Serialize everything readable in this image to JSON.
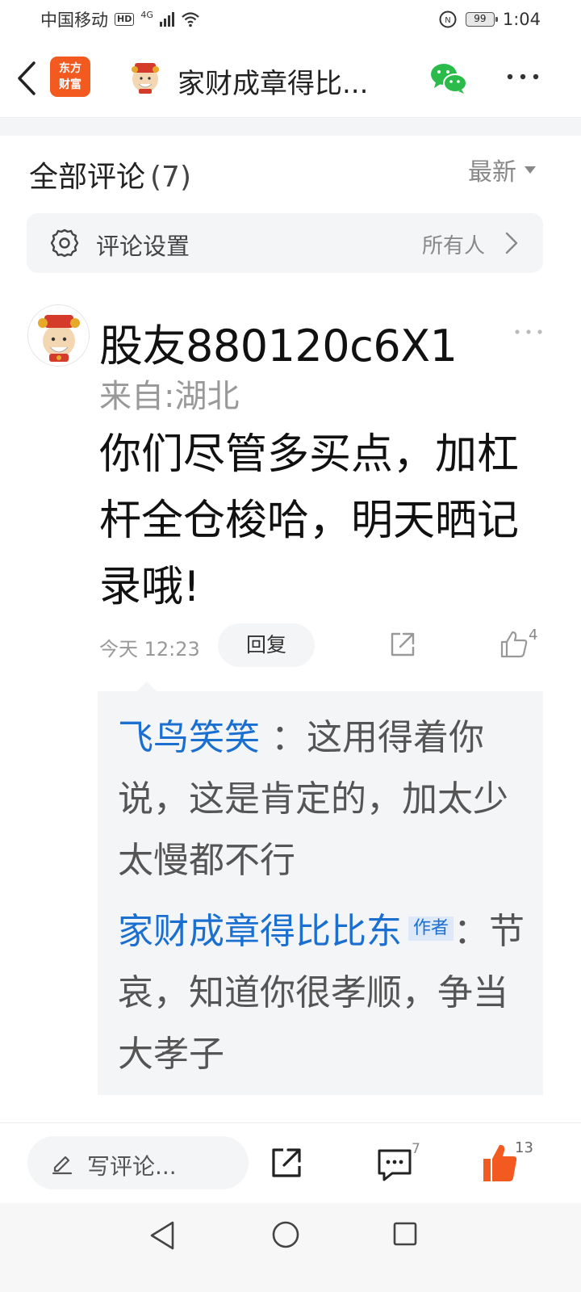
{
  "status_bar": {
    "carrier": "中国移动",
    "hd": "HD",
    "network": "4G",
    "battery": "99",
    "time": "1:04"
  },
  "nav": {
    "logo_line1": "东方",
    "logo_line2": "财富",
    "title": "家财成章得比..."
  },
  "comments_header": {
    "title": "全部评论",
    "count": "(7)",
    "sort_label": "最新"
  },
  "settings": {
    "label": "评论设置",
    "value": "所有人"
  },
  "comment": {
    "user": "股友880120c6X1",
    "location": "来自:湖北",
    "body": "你们尽管多买点，加杠杆全仓梭哈，明天晒记录哦!",
    "time": "今天 12:23",
    "reply_label": "回复",
    "like_count": "4",
    "replies": [
      {
        "user": "飞鸟笑笑",
        "separator": "：",
        "text": "这用得着你说，这是肯定的，加太少太慢都不行"
      },
      {
        "user": "家财成章得比比东",
        "tag": "作者",
        "separator": "：",
        "text": "节哀，知道你很孝顺，争当大孝子"
      }
    ]
  },
  "bottom_bar": {
    "placeholder": "写评论...",
    "comment_count": "7",
    "like_count": "13"
  },
  "colors": {
    "accent_orange": "#f25a1f",
    "link_blue": "#1a6fd1",
    "panel_gray": "#f4f5f7"
  }
}
